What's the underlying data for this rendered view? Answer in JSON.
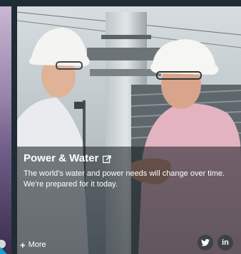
{
  "card": {
    "title": "Power & Water",
    "description": "The world's water and power needs will change over time. We're prepared for it today.",
    "more_label": "More",
    "more_icon": "+",
    "title_icon": "external-link-icon"
  },
  "social": {
    "twitter_icon": "twitter-icon",
    "linkedin_label": "in"
  },
  "colors": {
    "caption_overlay": "#141c22",
    "social_circle": "#3c4246",
    "accent": "#0fa3d6"
  }
}
